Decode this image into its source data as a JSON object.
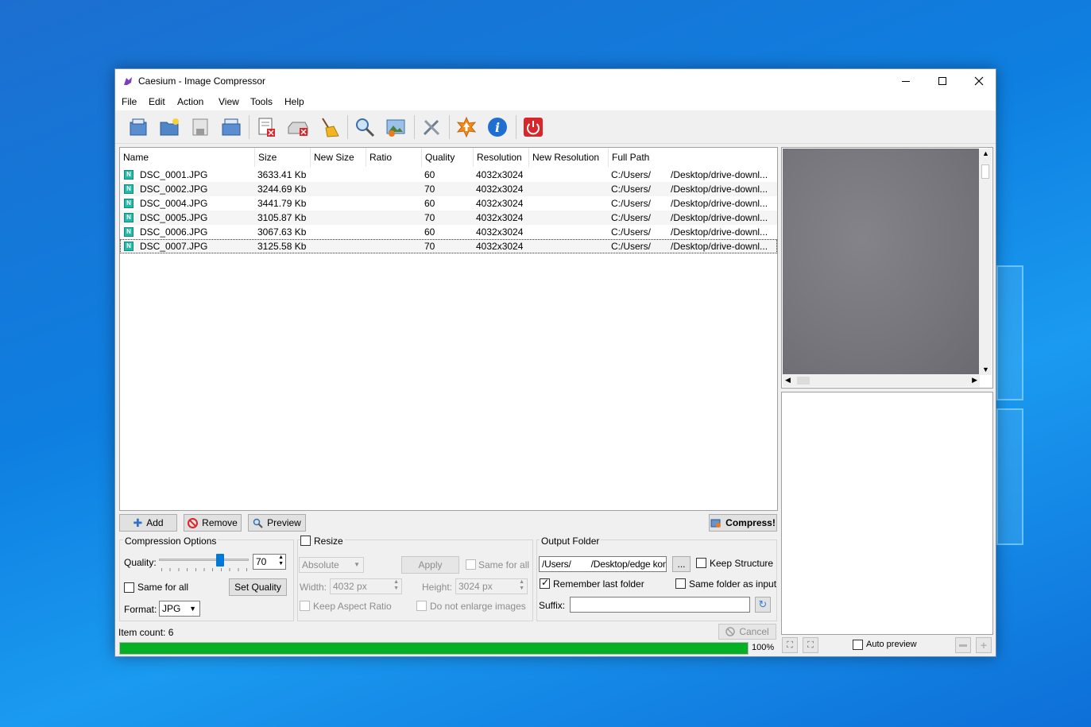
{
  "window": {
    "title": "Caesium - Image Compressor"
  },
  "menu": [
    "File",
    "Edit",
    "Action",
    "View",
    "Tools",
    "Help"
  ],
  "toolbar": [
    {
      "name": "add-files-icon"
    },
    {
      "name": "add-folder-icon"
    },
    {
      "name": "save-list-icon"
    },
    {
      "name": "open-list-icon"
    },
    {
      "name": "remove-items-icon"
    },
    {
      "name": "clear-list-icon"
    },
    {
      "name": "cleanup-broom-icon"
    },
    {
      "name": "search-icon"
    },
    {
      "name": "preview-image-icon"
    },
    {
      "name": "settings-tools-icon"
    },
    {
      "name": "update-icon"
    },
    {
      "name": "info-icon"
    },
    {
      "name": "power-exit-icon"
    }
  ],
  "table": {
    "columns": [
      "Name",
      "Size",
      "New Size",
      "Ratio",
      "Quality",
      "Resolution",
      "New Resolution",
      "Full Path"
    ],
    "rows": [
      {
        "icon": "N",
        "name": "DSC_0001.JPG",
        "size": "3633.41 Kb",
        "new_size": "",
        "ratio": "",
        "quality": "60",
        "resolution": "4032x3024",
        "new_resolution": "",
        "path_a": "C:/Users/",
        "path_b": "/Desktop/drive-downl..."
      },
      {
        "icon": "N",
        "name": "DSC_0002.JPG",
        "size": "3244.69 Kb",
        "new_size": "",
        "ratio": "",
        "quality": "70",
        "resolution": "4032x3024",
        "new_resolution": "",
        "path_a": "C:/Users/",
        "path_b": "/Desktop/drive-downl..."
      },
      {
        "icon": "N",
        "name": "DSC_0004.JPG",
        "size": "3441.79 Kb",
        "new_size": "",
        "ratio": "",
        "quality": "60",
        "resolution": "4032x3024",
        "new_resolution": "",
        "path_a": "C:/Users/",
        "path_b": "/Desktop/drive-downl..."
      },
      {
        "icon": "N",
        "name": "DSC_0005.JPG",
        "size": "3105.87 Kb",
        "new_size": "",
        "ratio": "",
        "quality": "70",
        "resolution": "4032x3024",
        "new_resolution": "",
        "path_a": "C:/Users/",
        "path_b": "/Desktop/drive-downl..."
      },
      {
        "icon": "N",
        "name": "DSC_0006.JPG",
        "size": "3067.63 Kb",
        "new_size": "",
        "ratio": "",
        "quality": "60",
        "resolution": "4032x3024",
        "new_resolution": "",
        "path_a": "C:/Users/",
        "path_b": "/Desktop/drive-downl..."
      },
      {
        "icon": "N",
        "name": "DSC_0007.JPG",
        "size": "3125.58 Kb",
        "new_size": "",
        "ratio": "",
        "quality": "70",
        "resolution": "4032x3024",
        "new_resolution": "",
        "path_a": "C:/Users/",
        "path_b": "/Desktop/drive-downl..."
      }
    ]
  },
  "actions": {
    "add": "Add",
    "remove": "Remove",
    "preview": "Preview",
    "compress": "Compress!"
  },
  "compression": {
    "title": "Compression Options",
    "quality_label": "Quality:",
    "quality_value": "70",
    "quality_fraction": 0.7,
    "same_for_all": "Same for all",
    "set_quality": "Set Quality",
    "format_label": "Format:",
    "format_value": "JPG"
  },
  "resize": {
    "title": "Resize",
    "mode": "Absolute",
    "apply": "Apply",
    "same_for_all": "Same for all",
    "width_label": "Width:",
    "width_value": "4032 px",
    "height_label": "Height:",
    "height_value": "3024 px",
    "keep_aspect": "Keep Aspect Ratio",
    "no_enlarge": "Do not enlarge images"
  },
  "output": {
    "title": "Output Folder",
    "path": "/Users/        /Desktop/edge komp",
    "browse": "...",
    "keep_structure": "Keep Structure",
    "remember_last": "Remember last folder",
    "same_folder": "Same folder as input",
    "suffix_label": "Suffix:",
    "suffix_value": ""
  },
  "status": {
    "item_count": "Item count: 6",
    "cancel": "Cancel",
    "progress_text": "100%",
    "progress_fraction": 1.0
  },
  "preview": {
    "auto_preview": "Auto preview"
  },
  "colors": {
    "progress": "#06b025",
    "accent": "#0078d7"
  }
}
